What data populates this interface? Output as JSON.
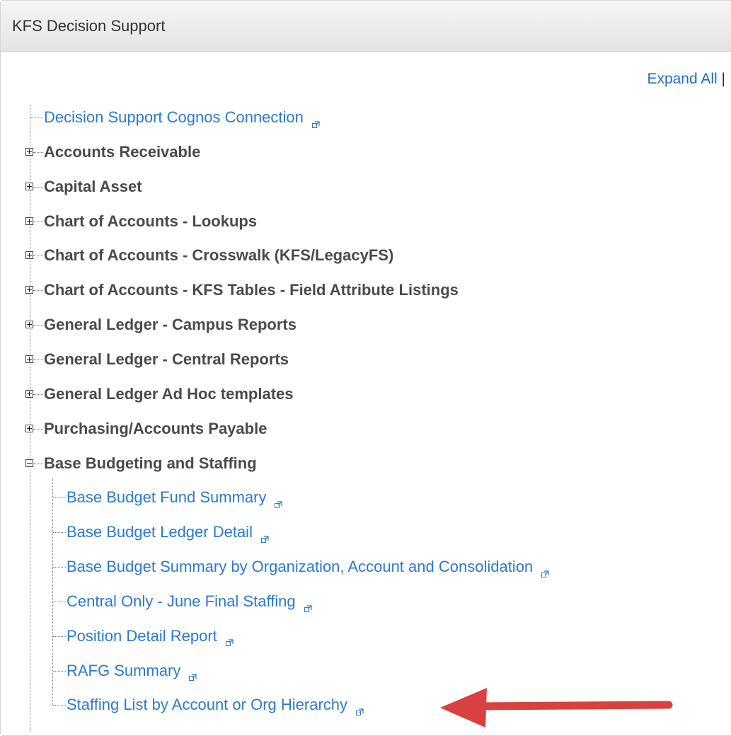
{
  "header": {
    "title": "KFS Decision Support"
  },
  "expand_all_label": "Expand All",
  "expand_separator": "|",
  "tree": {
    "root_link": "Decision Support Cognos Connection",
    "folders": [
      "Accounts Receivable",
      "Capital Asset",
      "Chart of Accounts - Lookups",
      "Chart of Accounts - Crosswalk (KFS/LegacyFS)",
      "Chart of Accounts - KFS Tables - Field Attribute Listings",
      "General Ledger - Campus Reports",
      "General Ledger - Central Reports",
      "General Ledger Ad Hoc templates",
      "Purchasing/Accounts Payable"
    ],
    "expanded_folder": "Base Budgeting and Staffing",
    "children": [
      "Base Budget Fund Summary",
      "Base Budget Ledger Detail",
      "Base Budget Summary by Organization, Account and Consolidation",
      "Central Only - June Final Staffing",
      "Position Detail Report",
      "RAFG Summary",
      "Staffing List by Account or Org Hierarchy"
    ]
  },
  "icons": {
    "external_link": "external-link-icon",
    "expand": "plus-box-icon",
    "collapse": "minus-box-icon"
  },
  "colors": {
    "link": "#2a7ad2",
    "folder": "#4a4a4a",
    "annotation_arrow": "#d94040"
  }
}
